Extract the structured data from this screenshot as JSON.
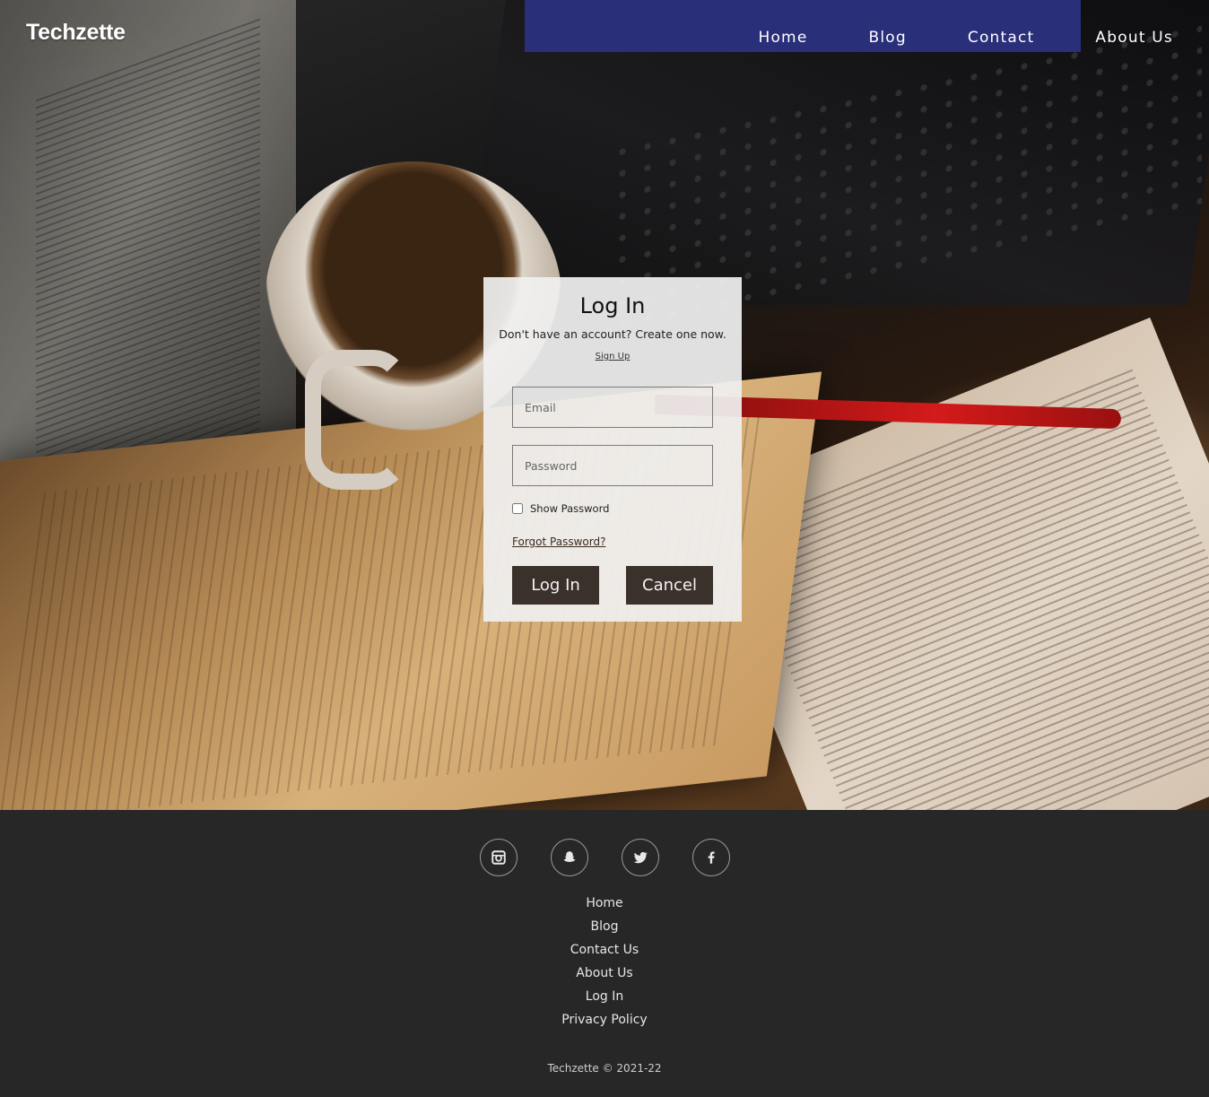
{
  "header": {
    "brand": "Techzette",
    "nav": [
      "Home",
      "Blog",
      "Contact",
      "About Us"
    ]
  },
  "login": {
    "title": "Log In",
    "subtitle": "Don't have an account? Create one now.",
    "signup_link": "Sign Up",
    "email_placeholder": "Email",
    "password_placeholder": "Password",
    "show_password_label": "Show Password",
    "forgot_link": "Forgot Password?",
    "login_button": "Log In",
    "cancel_button": "Cancel"
  },
  "footer": {
    "social_icons": [
      "instagram-icon",
      "snapchat-icon",
      "twitter-icon",
      "facebook-icon"
    ],
    "links": [
      "Home",
      "Blog",
      "Contact Us",
      "About Us",
      "Log In",
      "Privacy Policy"
    ],
    "copyright": "Techzette © 2021-22"
  }
}
